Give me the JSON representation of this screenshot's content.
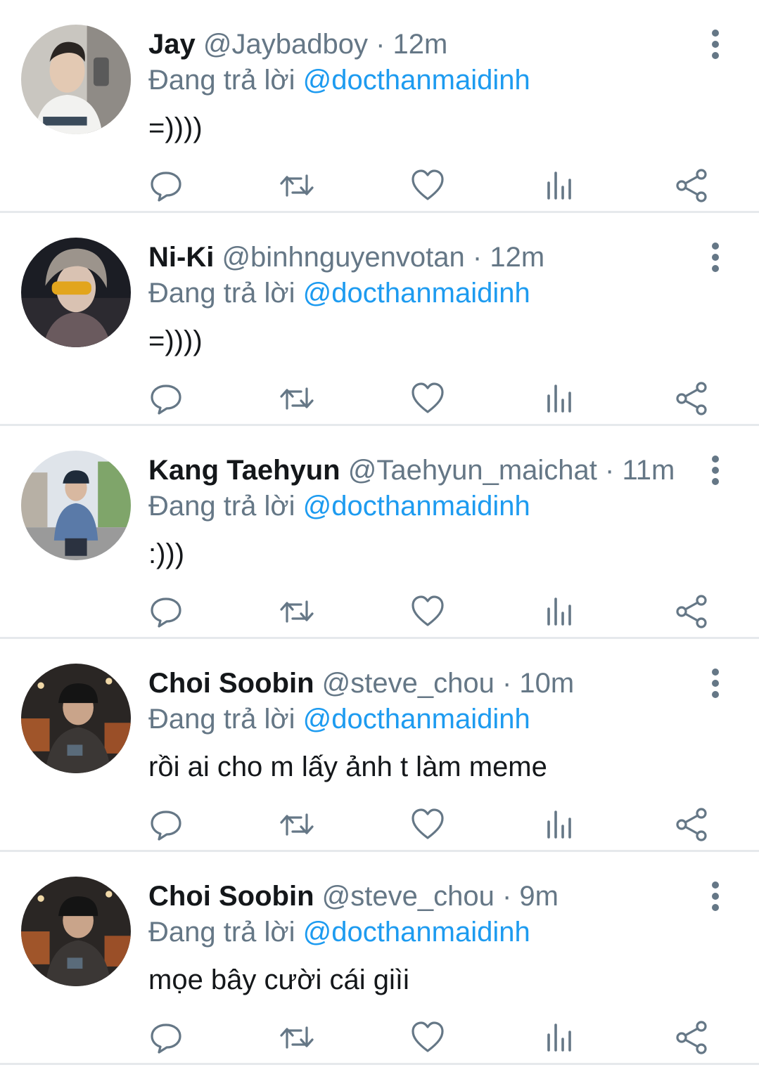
{
  "colors": {
    "name": "#14171a",
    "secondary": "#657786",
    "mention": "#1d9bf0",
    "divider": "#e6e9ec"
  },
  "icons": {
    "reply": "reply-icon",
    "retweet": "retweet-icon",
    "like": "heart-icon",
    "stats": "analytics-icon",
    "share": "share-icon",
    "more": "more-vertical-icon"
  },
  "tweets": [
    {
      "name": "Jay",
      "handle": "@Jaybadboy",
      "separator": "·",
      "time": "12m",
      "reply_prefix": "Đang trả lời",
      "reply_to": "@docthanmaidinh",
      "text": "=))))"
    },
    {
      "name": "Ni-Ki",
      "handle": "@binhnguyenvotan",
      "separator": "·",
      "time": "12m",
      "reply_prefix": "Đang trả lời",
      "reply_to": "@docthanmaidinh",
      "text": "=))))"
    },
    {
      "name": "Kang Taehyun",
      "handle": "@Taehyun_maichat",
      "separator": "·",
      "time": "11m",
      "reply_prefix": "Đang trả lời",
      "reply_to": "@docthanmaidinh",
      "text": ":)))"
    },
    {
      "name": "Choi Soobin",
      "handle": "@steve_chou",
      "separator": "·",
      "time": "10m",
      "reply_prefix": "Đang trả lời",
      "reply_to": "@docthanmaidinh",
      "text": "rồi ai cho m lấy ảnh t làm meme"
    },
    {
      "name": "Choi Soobin",
      "handle": "@steve_chou",
      "separator": "·",
      "time": "9m",
      "reply_prefix": "Đang trả lời",
      "reply_to": "@docthanmaidinh",
      "text": "mọe bây cười cái giìi"
    }
  ]
}
